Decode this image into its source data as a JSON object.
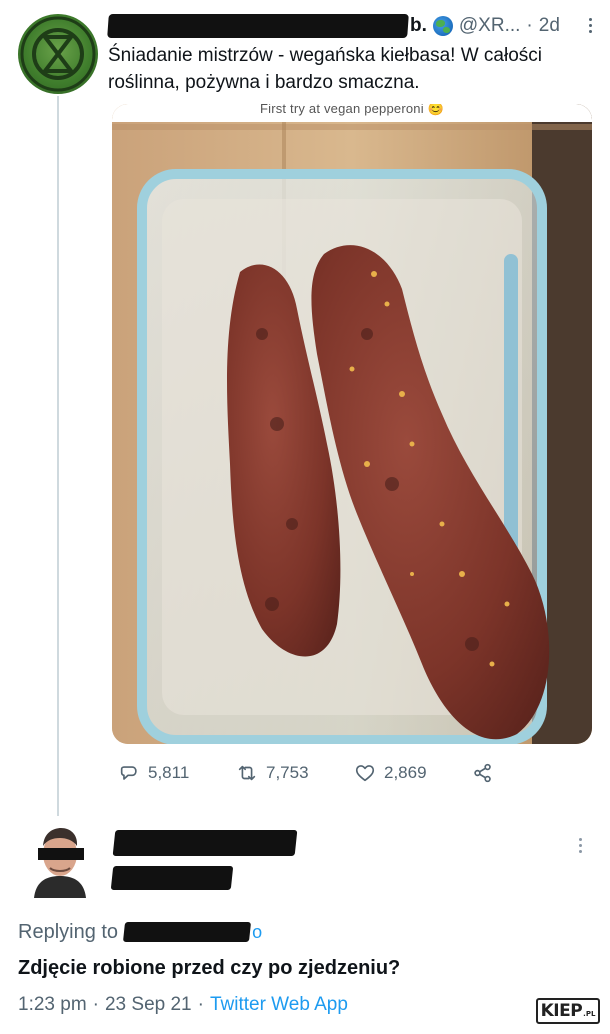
{
  "tweet": {
    "name_suffix": "b.",
    "handle": "@XR...",
    "dot": "·",
    "time": "2d",
    "text": "Śniadanie mistrzów - wegańska kiełbasa! W całości roślinna, pożywna i bardzo smaczna.",
    "photo": {
      "caption": "First try at vegan pepperoni 😊"
    },
    "stats": {
      "replies": "5,811",
      "retweets": "7,753",
      "likes": "2,869"
    }
  },
  "reply": {
    "replying_label": "Replying to",
    "replying_tail": "o",
    "text": "Zdjęcie robione przed czy po zjedzeniu?",
    "time": "1:23 pm",
    "date": "23 Sep 21",
    "sep": "·",
    "source": "Twitter Web App"
  },
  "watermark": {
    "main": "KIEP",
    "tld": ".PL"
  },
  "icons": {
    "reply": "speech-bubble-icon",
    "retweet": "retweet-icon",
    "like": "heart-icon",
    "share": "share-icon",
    "more": "more-vertical-icon",
    "globe": "globe-icon"
  },
  "colors": {
    "text": "#0f1419",
    "muted": "#536471",
    "link": "#1d9bf0",
    "thread_line": "#cfd9de"
  }
}
